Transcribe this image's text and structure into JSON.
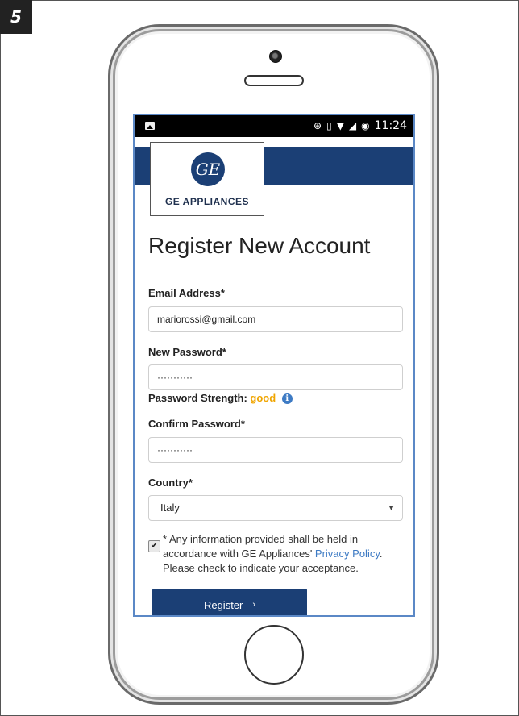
{
  "step_number": "5",
  "status_bar": {
    "time": "11:24",
    "icons": [
      "image-notification-icon",
      "data-saver-icon",
      "vibrate-icon",
      "wifi-icon",
      "signal-icon",
      "battery-icon"
    ]
  },
  "brand": {
    "monogram": "GE",
    "name": "GE APPLIANCES"
  },
  "page_title": "Register New Account",
  "form": {
    "email_label": "Email Address*",
    "email_value": "mariorossi@gmail.com",
    "password_label": "New Password*",
    "password_value": "···········",
    "strength_label": "Password Strength:",
    "strength_value": "good",
    "confirm_label": "Confirm Password*",
    "confirm_value": "···········",
    "country_label": "Country*",
    "country_value": "Italy"
  },
  "consent": {
    "checked": true,
    "text_before": "* Any information provided shall be held in accordance with GE Appliances' ",
    "link_text": "Privacy Policy",
    "text_after": ". Please check to indicate your acceptance."
  },
  "register_label": "Register",
  "colors": {
    "brand_blue": "#1b3f75",
    "strength_good": "#f0a500",
    "link": "#3e7bc4"
  }
}
